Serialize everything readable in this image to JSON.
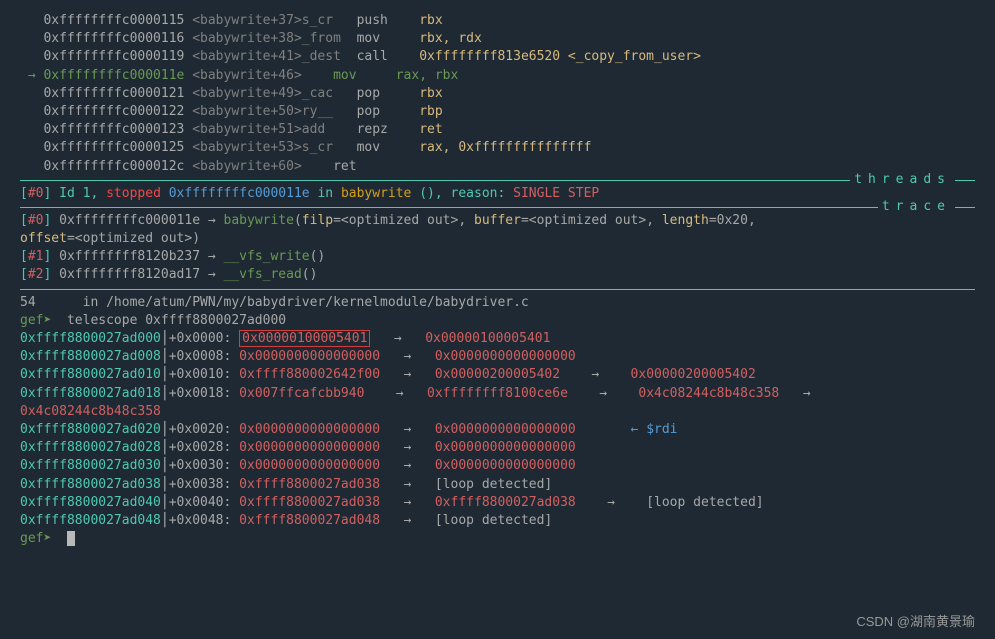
{
  "asm": [
    {
      "addr": "0xffffffffc0000115",
      "sym": "<babywrite+37>",
      "ghost": "s_cr",
      "op": "push",
      "args": "rbx",
      "current": false
    },
    {
      "addr": "0xffffffffc0000116",
      "sym": "<babywrite+38>",
      "ghost": "_from",
      "op": "mov",
      "args": "rbx, rdx",
      "current": false
    },
    {
      "addr": "0xffffffffc0000119",
      "sym": "<babywrite+41>",
      "ghost": "_dest",
      "op": "call",
      "args": "0xffffffff813e6520 <_copy_from_user>",
      "current": false
    },
    {
      "addr": "0xffffffffc000011e",
      "sym": "<babywrite+46>",
      "ghost": "",
      "op": "mov",
      "args": "rax, rbx",
      "current": true
    },
    {
      "addr": "0xffffffffc0000121",
      "sym": "<babywrite+49>",
      "ghost": "_cac",
      "op": "pop",
      "args": "rbx",
      "current": false
    },
    {
      "addr": "0xffffffffc0000122",
      "sym": "<babywrite+50>",
      "ghost": "ry__",
      "op": "pop",
      "args": "rbp",
      "current": false
    },
    {
      "addr": "0xffffffffc0000123",
      "sym": "<babywrite+51>",
      "ghost": "add",
      "op": "repz",
      "args": "ret",
      "current": false
    },
    {
      "addr": "0xffffffffc0000125",
      "sym": "<babywrite+53>",
      "ghost": "s_cr",
      "op": "mov",
      "args": "rax, 0xfffffffffffffff",
      "current": false
    },
    {
      "addr": "0xffffffffc000012c",
      "sym": "<babywrite+60>",
      "ghost": "",
      "op": "ret",
      "args": "",
      "current": false
    }
  ],
  "threads": {
    "label": "threads",
    "line_prefix": "[",
    "idx": "#0",
    "id_label": "] Id 1, ",
    "stopped": "stopped",
    "addr": "0xffffffffc000011e",
    "in": " in ",
    "func": "babywrite",
    "tail": " (), reason: ",
    "reason": "SINGLE STEP"
  },
  "trace": {
    "label": "trace",
    "frames": [
      {
        "idx": "#0",
        "addr": "0xffffffffc000011e",
        "arrow": "→",
        "func": "babywrite",
        "args": "(filp=<optimized out>, buffer=<optimized out>, length=0x20, offset=<optimized out>)"
      },
      {
        "idx": "#1",
        "addr": "0xffffffff8120b237",
        "arrow": "→",
        "func": "__vfs_write",
        "args": "()"
      },
      {
        "idx": "#2",
        "addr": "0xffffffff8120ad17",
        "arrow": "→",
        "func": "__vfs_read",
        "args": "()"
      }
    ],
    "rich_args": {
      "filp_k": "filp",
      "filp_v": "=<optimized out>, ",
      "buffer_k": "buffer",
      "buffer_v": "=<optimized out>, ",
      "length_k": "length",
      "length_v": "=0x20, ",
      "offset_k": "offset",
      "offset_v": "=<optimized out>)"
    }
  },
  "source": {
    "line_no": "54",
    "path": "in /home/atum/PWN/my/babydriver/kernelmodule/babydriver.c"
  },
  "gef": {
    "prompt": "gef➤ ",
    "cmd": "telescope 0xffff8800027ad000"
  },
  "telescope": [
    {
      "addr": "0xffff8800027ad000",
      "off": "+0x0000:",
      "v1": "0x00000100005401",
      "box": true,
      "v2": "0x00000100005401"
    },
    {
      "addr": "0xffff8800027ad008",
      "off": "+0x0008:",
      "v1": "0x0000000000000000",
      "v2": "0x0000000000000000"
    },
    {
      "addr": "0xffff8800027ad010",
      "off": "+0x0010:",
      "v1": "0xffff880002642f00",
      "v2": "0x00000200005402",
      "v3": "0x00000200005402"
    },
    {
      "addr": "0xffff8800027ad018",
      "off": "+0x0018:",
      "v1": "0x007ffcafcbb940",
      "v2": "0xffffffff8100ce6e",
      "v3": "0x4c08244c8b48c358",
      "v4": "0x4c08244c8b48c358"
    },
    {
      "addr": "0xffff8800027ad020",
      "off": "+0x0020:",
      "v1": "0x0000000000000000",
      "v2": "0x0000000000000000",
      "reg": "← $rdi"
    },
    {
      "addr": "0xffff8800027ad028",
      "off": "+0x0028:",
      "v1": "0x0000000000000000",
      "v2": "0x0000000000000000"
    },
    {
      "addr": "0xffff8800027ad030",
      "off": "+0x0030:",
      "v1": "0x0000000000000000",
      "v2": "0x0000000000000000"
    },
    {
      "addr": "0xffff8800027ad038",
      "off": "+0x0038:",
      "v1": "0xffff8800027ad038",
      "v2": "[loop detected]"
    },
    {
      "addr": "0xffff8800027ad040",
      "off": "+0x0040:",
      "v1": "0xffff8800027ad038",
      "v2": "0xffff8800027ad038",
      "v3": "[loop detected]"
    },
    {
      "addr": "0xffff8800027ad048",
      "off": "+0x0048:",
      "v1": "0xffff8800027ad048",
      "v2": "[loop detected]"
    }
  ],
  "watermark": "CSDN @湖南黄景瑜"
}
